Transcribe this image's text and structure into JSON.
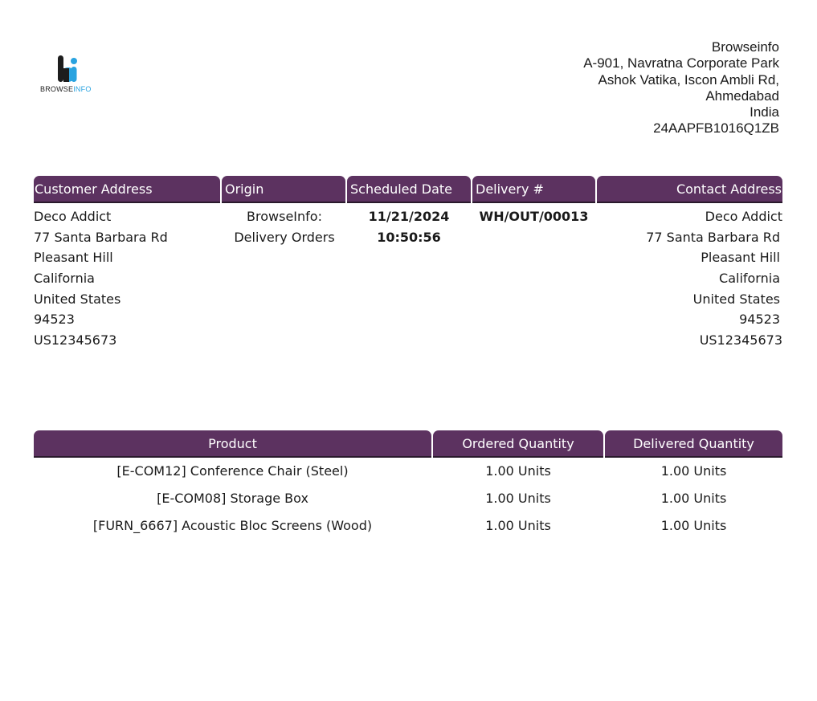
{
  "logo": {
    "brand_dark": "BROWSE",
    "brand_blue": "INFO",
    "colors": {
      "dark": "#1d1d1d",
      "blue": "#29a3e0"
    }
  },
  "company": {
    "lines": [
      "Browseinfo",
      "A-901, Navratna Corporate Park",
      "Ashok Vatika, Iscon Ambli Rd,",
      "Ahmedabad",
      "India",
      "24AAPFB1016Q1ZB"
    ]
  },
  "info_table": {
    "headers": {
      "customer_address": "Customer Address",
      "origin": "Origin",
      "scheduled_date": "Scheduled Date",
      "delivery_no": "Delivery #",
      "contact_address": "Contact Address"
    },
    "customer_address": [
      "Deco Addict",
      "77 Santa Barbara Rd",
      "Pleasant Hill",
      "California",
      "United States",
      "94523",
      "US12345673"
    ],
    "origin": [
      "BrowseInfo:",
      "Delivery Orders"
    ],
    "scheduled_date": [
      "11/21/2024",
      "10:50:56"
    ],
    "delivery_no": "WH/OUT/00013",
    "contact_address": [
      "Deco Addict",
      "77 Santa Barbara Rd",
      "Pleasant Hill",
      "California",
      "United States",
      "94523",
      "US12345673"
    ]
  },
  "products_table": {
    "headers": {
      "product": "Product",
      "ordered": "Ordered Quantity",
      "delivered": "Delivered Quantity"
    },
    "rows": [
      {
        "product": "[E-COM12] Conference Chair (Steel)",
        "ordered": "1.00 Units",
        "delivered": "1.00 Units"
      },
      {
        "product": "[E-COM08] Storage Box",
        "ordered": "1.00 Units",
        "delivered": "1.00 Units"
      },
      {
        "product": "[FURN_6667] Acoustic Bloc Screens (Wood)",
        "ordered": "1.00 Units",
        "delivered": "1.00 Units"
      }
    ]
  },
  "colors": {
    "header_bg": "#5c3260",
    "header_text": "#ffffff"
  }
}
